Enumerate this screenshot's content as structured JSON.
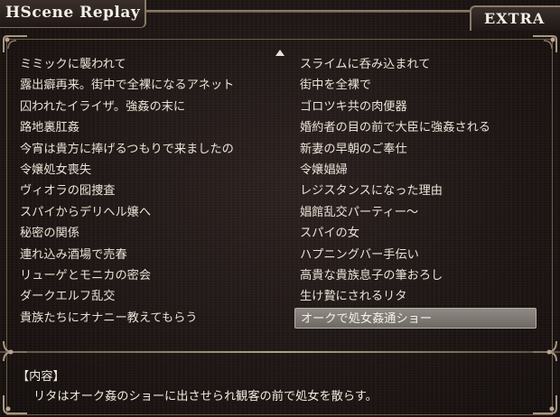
{
  "header": {
    "title": "HScene Replay",
    "tab": "EXTRA"
  },
  "replay_list": {
    "left": [
      "ミミックに襲われて",
      "露出癖再来。街中で全裸になるアネット",
      "囚われたイライザ。強姦の末に",
      "路地裏肛姦",
      "今宵は貴方に捧げるつもりで来ましたの",
      "令嬢処女喪失",
      "ヴィオラの囮捜査",
      "スパイからデリヘル嬢へ",
      "秘密の関係",
      "連れ込み酒場で売春",
      "リューゲとモニカの密会",
      "ダークエルフ乱交",
      "貴族たちにオナニー教えてもらう"
    ],
    "right": [
      "スライムに呑み込まれて",
      "街中を全裸で",
      "ゴロツキ共の肉便器",
      "婚約者の目の前で大臣に強姦される",
      "新妻の早朝のご奉仕",
      "令嬢娼婦",
      "レジスタンスになった理由",
      "娼館乱交パーティー～",
      "スパイの女",
      "ハプニングバー手伝い",
      "高貴な貴族息子の筆おろし",
      "生け贄にされるリタ",
      "オークで処女姦通ショー"
    ],
    "selected": "オークで処女姦通ショー"
  },
  "info": {
    "label": "【内容】",
    "text": "リタはオーク姦のショーに出させられ観客の前で処女を散らす。"
  },
  "icons": {
    "scroll": "scroll-up-arrow-icon",
    "corners": "ornate-corner-icon"
  },
  "colors": {
    "text": "#e8e2d6",
    "selection": "#807a74",
    "frame": "#9a8b78"
  }
}
